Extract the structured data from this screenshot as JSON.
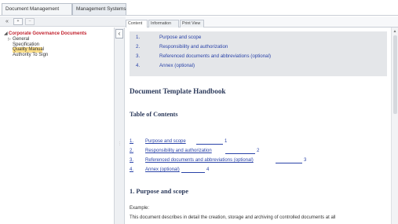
{
  "top_tabs": {
    "tab0": "Document Management",
    "tab1": "Management Systems"
  },
  "left_toolbar": {
    "collapse_all": "«",
    "add": "+",
    "remove": "–"
  },
  "tree": {
    "root": "Corporate Governance Documents",
    "root_caret": "◢",
    "child_caret": "▷",
    "general": "General",
    "specification": "Specification",
    "quality_manual": "Quality Manual",
    "authority_to_sign": "Authority To Sign"
  },
  "splitter": {
    "collapse": "‹",
    "grip": "⋮"
  },
  "content_tabs": {
    "content": "Content",
    "information": "Information",
    "print_view": "Print View"
  },
  "toc_box": [
    {
      "num": "1.",
      "text": "Purpose and scope"
    },
    {
      "num": "2.",
      "text": "Responsibility and authorization"
    },
    {
      "num": "3.",
      "text": "Referenced documents and abbreviations (optional)"
    },
    {
      "num": "4.",
      "text": "Annex (optional)"
    }
  ],
  "document": {
    "title": "Document Template Handbook",
    "toc_heading": "Table of Contents",
    "toc": [
      {
        "num": "1.",
        "text": "Purpose and scope",
        "page": "1"
      },
      {
        "num": "2.",
        "text": "Responsibility and authorization",
        "page": "2"
      },
      {
        "num": "3.",
        "text": "Referenced documents and abbreviations (optional)",
        "page": "3"
      },
      {
        "num": "4.",
        "text": "Annex (optional)",
        "page": "4"
      }
    ],
    "section1": "1.  Purpose and scope",
    "example_label": "Example:",
    "body": "This document describes in detail the creation, storage and archiving of controlled documents at all"
  },
  "scrollbar": {
    "up_arrow": "▲"
  }
}
